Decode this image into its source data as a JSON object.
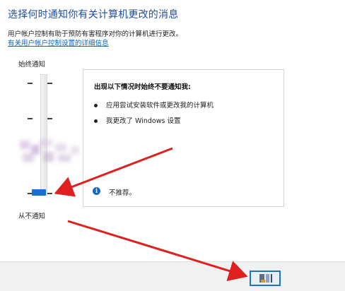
{
  "header": {
    "title": "选择何时通知你有关计算机更改的消息",
    "description": "用户帐户控制有助于预防有害程序对你的计算机进行更改。",
    "link": "有关用户帐户控制设置的详细信息"
  },
  "slider": {
    "top_label": "始终通知",
    "bottom_label": "从不通知",
    "level": 0,
    "levels": 4
  },
  "panel": {
    "heading": "出现以下情况时始终不要通知我:",
    "bullets": [
      "应用尝试安装软件或更改我的计算机",
      "我更改了 Windows 设置"
    ],
    "info_icon_glyph": "i",
    "info_text": "不推荐。"
  },
  "colors": {
    "accent": "#1572d0",
    "title": "#1f4e9e",
    "link": "#0a63c9",
    "arrow": "#e0201f"
  }
}
